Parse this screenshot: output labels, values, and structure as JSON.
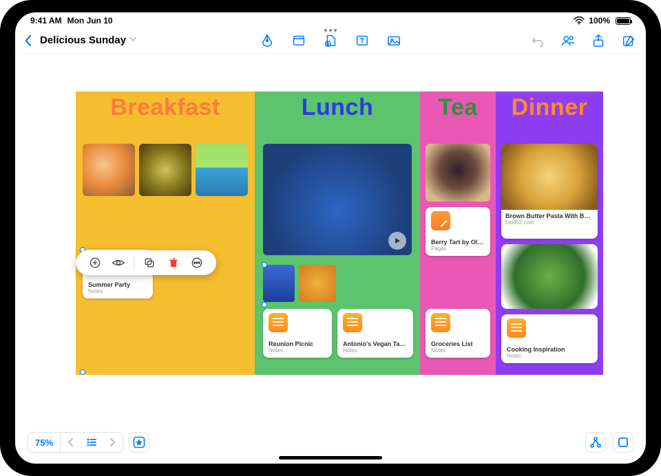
{
  "statusbar": {
    "time": "9:41 AM",
    "date": "Mon Jun 10",
    "battery_pct": "100%"
  },
  "toolbar": {
    "back_label": "Delicious Sunday"
  },
  "columns": {
    "breakfast": {
      "title": "Breakfast"
    },
    "lunch": {
      "title": "Lunch"
    },
    "tea": {
      "title": "Tea"
    },
    "dinner": {
      "title": "Dinner"
    }
  },
  "cards": {
    "breakfast_note": {
      "title": "Summer Party",
      "sub": "Notes"
    },
    "lunch_note1": {
      "title": "Reunion Picnic",
      "sub": "Notes"
    },
    "lunch_note2": {
      "title": "Antonio's Vegan Tacos",
      "sub": "Notes"
    },
    "tea_pages": {
      "title": "Berry Tart by Olivia",
      "sub": "Pages"
    },
    "tea_note": {
      "title": "Groceries List",
      "sub": "Notes"
    },
    "dinner_link": {
      "title": "Brown Butter Pasta With But…",
      "sub": "food52.com"
    },
    "dinner_note": {
      "title": "Cooking Inspiration",
      "sub": "Notes"
    }
  },
  "bottom": {
    "zoom": "75%"
  }
}
